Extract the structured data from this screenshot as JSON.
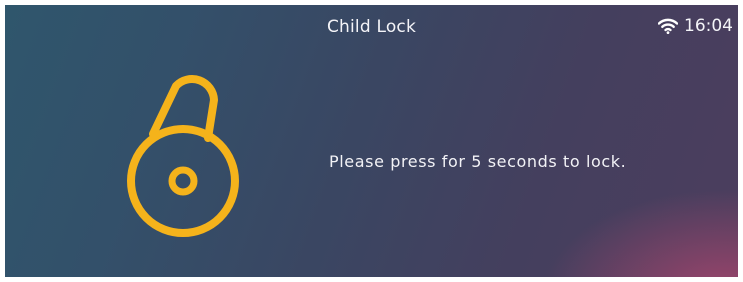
{
  "header": {
    "title": "Child Lock",
    "time": "16:04",
    "wifi_icon": "wifi-icon"
  },
  "main": {
    "lock_icon": "unlocked-padlock-icon",
    "lock_color": "#f5b31b",
    "message": "Please press for 5 seconds to lock."
  }
}
